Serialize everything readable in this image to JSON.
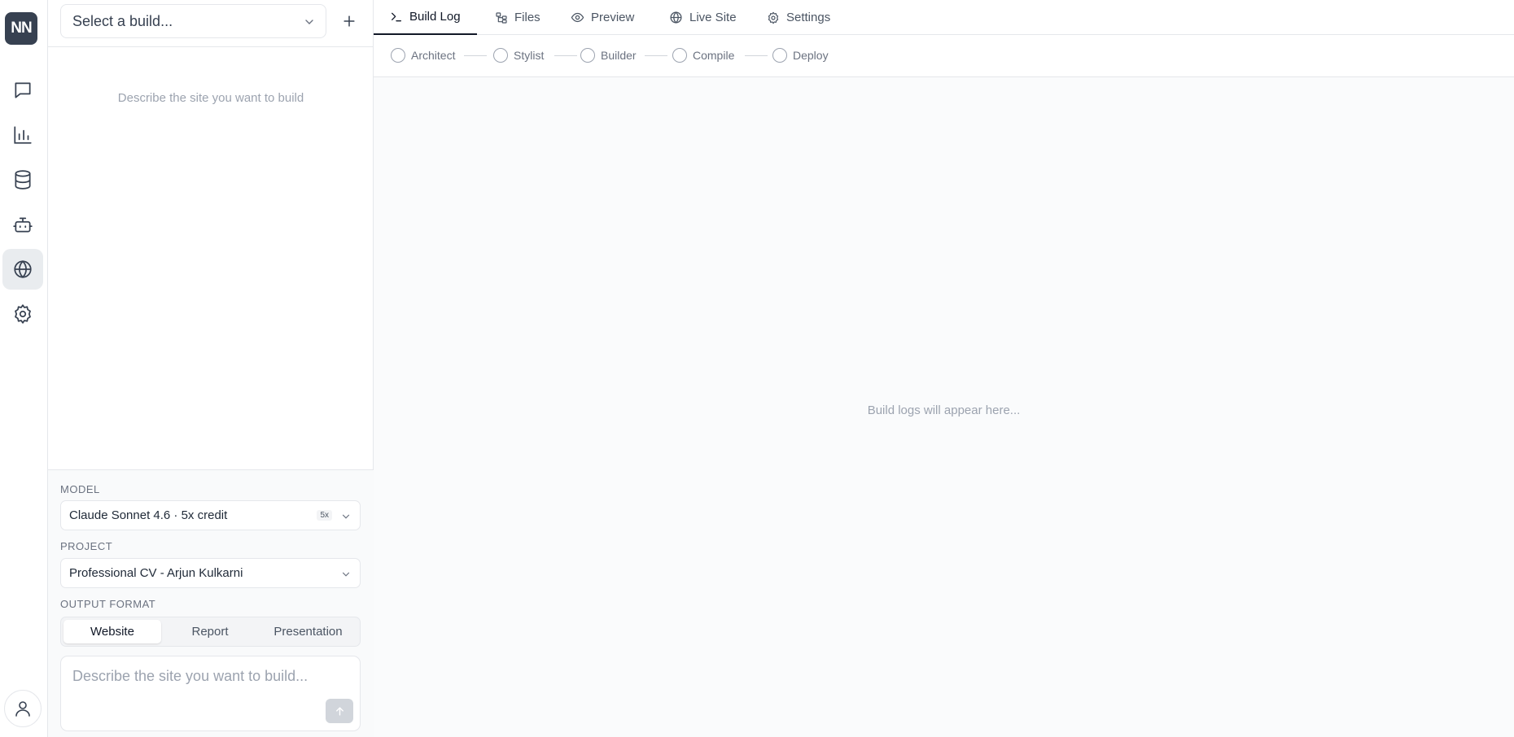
{
  "app": {
    "logo_text": "NN"
  },
  "rail": {
    "items": [
      {
        "icon": "chat-icon",
        "active": false
      },
      {
        "icon": "bar-chart-icon",
        "active": false
      },
      {
        "icon": "database-icon",
        "active": false
      },
      {
        "icon": "bot-icon",
        "active": false
      },
      {
        "icon": "globe-icon",
        "active": true
      },
      {
        "icon": "gear-icon",
        "active": false
      }
    ],
    "user_icon": "user-icon"
  },
  "panel": {
    "build_select_placeholder": "Select a build...",
    "empty_hint": "Describe the site you want to build",
    "model_label": "MODEL",
    "model_value": "Claude Sonnet 4.6 · 5x credit",
    "model_badge": "5x",
    "project_label": "PROJECT",
    "project_value": "Professional CV - Arjun Kulkarni",
    "output_label": "OUTPUT FORMAT",
    "output_options": [
      "Website",
      "Report",
      "Presentation"
    ],
    "output_selected": "Website",
    "prompt_placeholder": "Describe the site you want to build..."
  },
  "main": {
    "tabs": [
      {
        "label": "Build Log",
        "icon": "terminal-icon",
        "active": true
      },
      {
        "label": "Files",
        "icon": "file-tree-icon",
        "active": false
      },
      {
        "label": "Preview",
        "icon": "eye-icon",
        "active": false
      },
      {
        "label": "Live Site",
        "icon": "globe-icon",
        "active": false
      },
      {
        "label": "Settings",
        "icon": "gear-icon",
        "active": false
      }
    ],
    "pipeline_steps": [
      "Architect",
      "Stylist",
      "Builder",
      "Compile",
      "Deploy"
    ],
    "log_empty_text": "Build logs will appear here..."
  },
  "colors": {
    "accent": "#111827",
    "logo_bg": "#374151",
    "active_rail_bg": "#e9ecef",
    "muted_text": "#9ca3af"
  }
}
